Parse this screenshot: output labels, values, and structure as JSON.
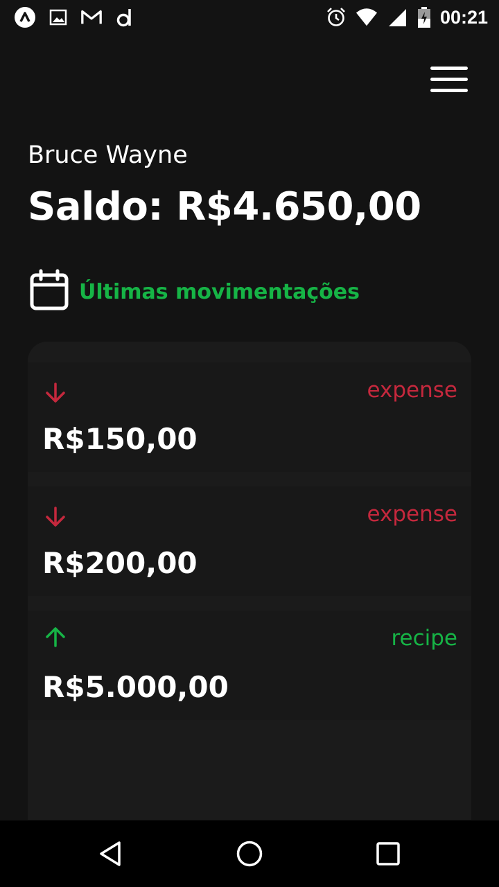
{
  "status_bar": {
    "time": "00:21",
    "left_icons": [
      "app-a-icon",
      "image-icon",
      "gmail-icon",
      "app-d-icon"
    ],
    "right_icons": [
      "alarm-icon",
      "wifi-icon",
      "cell-signal-icon",
      "battery-icon"
    ]
  },
  "header": {
    "menu_icon": "hamburger-menu-icon"
  },
  "user": {
    "name": "Bruce Wayne",
    "balance": "Saldo: R$4.650,00"
  },
  "section": {
    "icon": "calendar-icon",
    "title": "Últimas movimentações"
  },
  "transactions": [
    {
      "type": "expense",
      "amount": "R$150,00",
      "direction": "down",
      "color": "#c5283d"
    },
    {
      "type": "expense",
      "amount": "R$200,00",
      "direction": "down",
      "color": "#c5283d"
    },
    {
      "type": "recipe",
      "amount": "R$5.000,00",
      "direction": "up",
      "color": "#16b446"
    }
  ],
  "colors": {
    "background": "#131313",
    "accent_green": "#16b446",
    "expense_red": "#c5283d"
  },
  "nav_bar": {
    "icons": [
      "back-triangle-icon",
      "home-circle-icon",
      "recents-square-icon"
    ]
  }
}
